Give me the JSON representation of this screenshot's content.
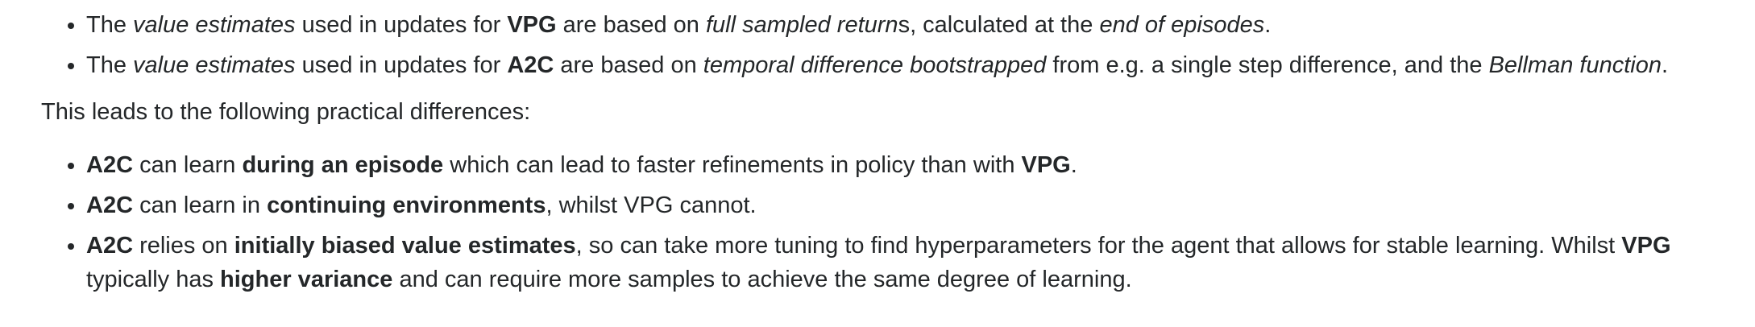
{
  "list1": [
    {
      "parts": [
        {
          "t": "The ",
          "s": "n"
        },
        {
          "t": "value estimates",
          "s": "i"
        },
        {
          "t": " used in updates for ",
          "s": "n"
        },
        {
          "t": "VPG",
          "s": "b"
        },
        {
          "t": " are based on ",
          "s": "n"
        },
        {
          "t": "full sampled return",
          "s": "i"
        },
        {
          "t": "s, calculated at the ",
          "s": "n"
        },
        {
          "t": "end of episodes",
          "s": "i"
        },
        {
          "t": ".",
          "s": "n"
        }
      ]
    },
    {
      "parts": [
        {
          "t": "The ",
          "s": "n"
        },
        {
          "t": "value estimates",
          "s": "i"
        },
        {
          "t": " used in updates for ",
          "s": "n"
        },
        {
          "t": "A2C",
          "s": "b"
        },
        {
          "t": " are based on ",
          "s": "n"
        },
        {
          "t": "temporal difference bootstrapped",
          "s": "i"
        },
        {
          "t": " from e.g. a single step difference, and the ",
          "s": "n"
        },
        {
          "t": "Bellman function",
          "s": "i"
        },
        {
          "t": ".",
          "s": "n"
        }
      ]
    }
  ],
  "paragraph": "This leads to the following practical differences:",
  "list2": [
    {
      "parts": [
        {
          "t": "A2C",
          "s": "b"
        },
        {
          "t": " can learn ",
          "s": "n"
        },
        {
          "t": "during an episode",
          "s": "b"
        },
        {
          "t": " which can lead to faster refinements in policy than with ",
          "s": "n"
        },
        {
          "t": "VPG",
          "s": "b"
        },
        {
          "t": ".",
          "s": "n"
        }
      ]
    },
    {
      "parts": [
        {
          "t": "A2C",
          "s": "b"
        },
        {
          "t": " can learn in ",
          "s": "n"
        },
        {
          "t": "continuing environments",
          "s": "b"
        },
        {
          "t": ", whilst VPG cannot.",
          "s": "n"
        }
      ]
    },
    {
      "parts": [
        {
          "t": "A2C",
          "s": "b"
        },
        {
          "t": " relies on ",
          "s": "n"
        },
        {
          "t": "initially biased value estimates",
          "s": "b"
        },
        {
          "t": ", so can take more tuning to find hyperparameters for the agent that allows for stable learning. Whilst ",
          "s": "n"
        },
        {
          "t": "VPG",
          "s": "b"
        },
        {
          "t": " typically has ",
          "s": "n"
        },
        {
          "t": "higher variance",
          "s": "b"
        },
        {
          "t": " and can require more samples to achieve the same degree of learning.",
          "s": "n"
        }
      ]
    }
  ]
}
